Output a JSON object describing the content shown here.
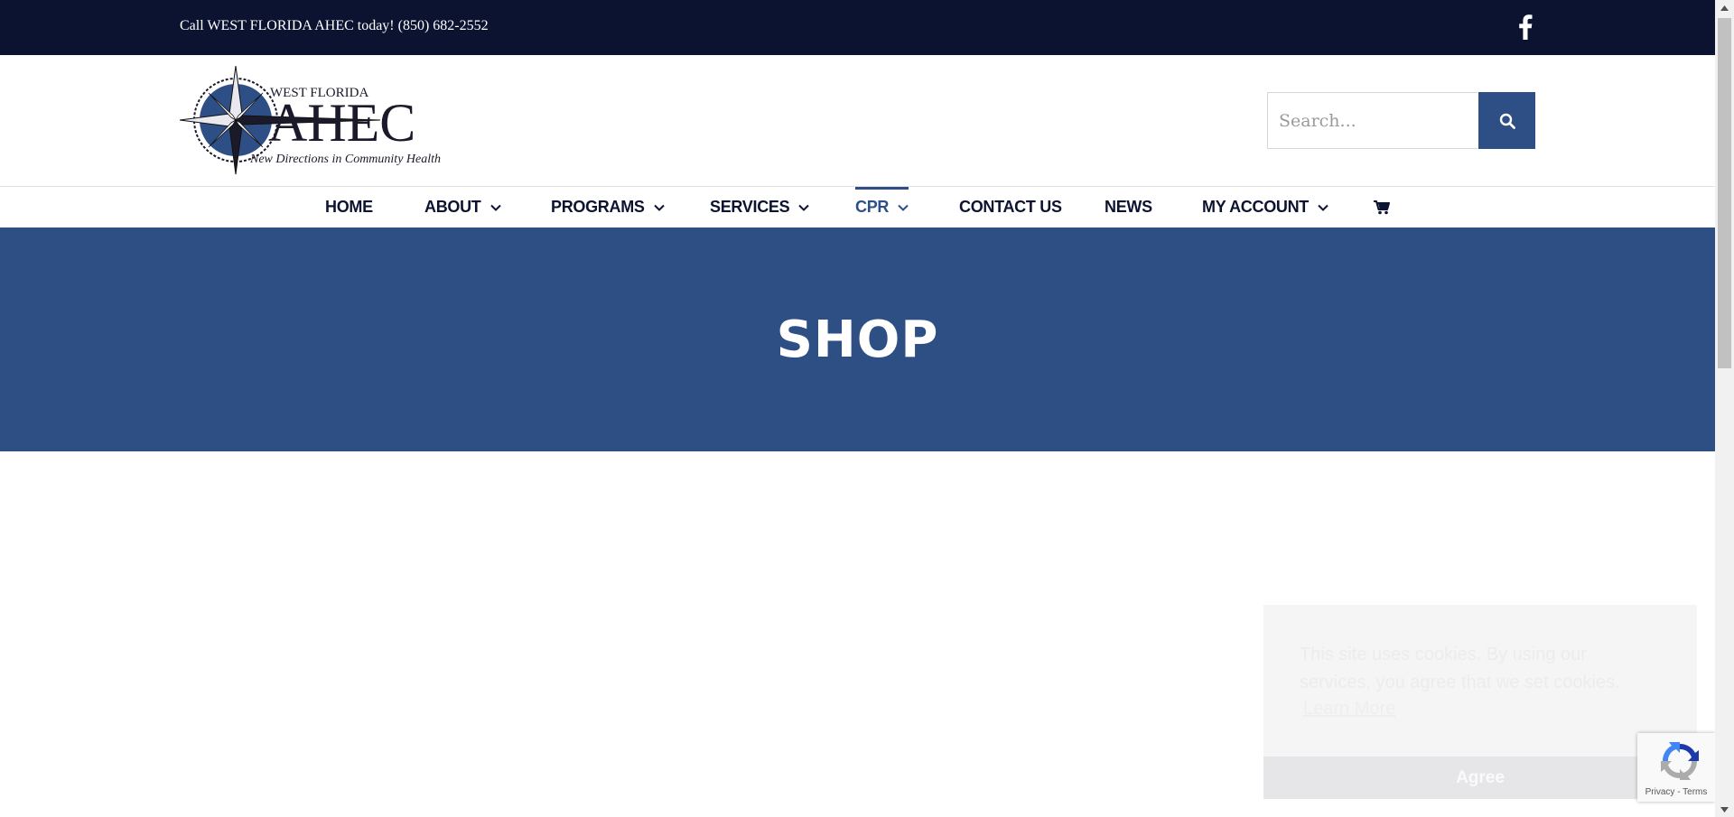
{
  "topbar": {
    "phone_text": "Call WEST FLORIDA AHEC today! (850) 682-2552",
    "social_icon": "facebook-icon"
  },
  "header": {
    "logo": {
      "top_text": "WEST FLORIDA",
      "main_text": "AHEC",
      "tagline": "New Directions in Community Health"
    },
    "search": {
      "placeholder": "Search...",
      "button_icon": "search-icon"
    }
  },
  "nav": {
    "items": [
      {
        "label": "HOME",
        "has_dropdown": false
      },
      {
        "label": "ABOUT",
        "has_dropdown": true
      },
      {
        "label": "PROGRAMS",
        "has_dropdown": true
      },
      {
        "label": "SERVICES",
        "has_dropdown": true
      },
      {
        "label": "CPR",
        "has_dropdown": true,
        "active": true
      },
      {
        "label": "CONTACT US",
        "has_dropdown": false
      },
      {
        "label": "NEWS",
        "has_dropdown": false
      },
      {
        "label": "MY ACCOUNT",
        "has_dropdown": true
      }
    ],
    "cart_icon": "cart-icon"
  },
  "page_title": "SHOP",
  "cookie_notice": {
    "message": "This site uses cookies. By using our services, you agree that we set cookies.",
    "learn_more": "Learn More",
    "agree": "Agree"
  },
  "recaptcha": {
    "privacy": "Privacy",
    "separator": " - ",
    "terms": "Terms"
  },
  "colors": {
    "topbar_bg": "#0b1330",
    "accent": "#2e4f86",
    "title_band": "#2e4f84",
    "nav_text": "#0b1330"
  }
}
